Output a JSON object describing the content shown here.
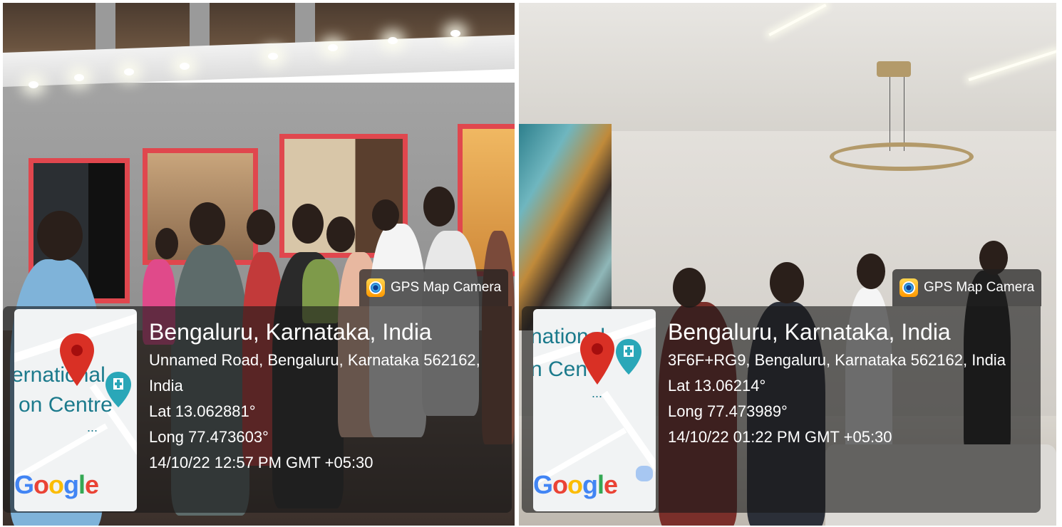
{
  "left": {
    "app_name": "GPS Map Camera",
    "location_title": "Bengaluru, Karnataka, India",
    "address_line1": "Unnamed Road, Bengaluru, Karnataka 562162,",
    "address_line2": "India",
    "latitude": "Lat 13.062881°",
    "longitude": "Long 77.473603°",
    "timestamp": "14/10/22 12:57 PM GMT +05:30",
    "map_text_line1": "ernational",
    "map_text_line2": "on Centre",
    "map_dots": "...",
    "map_logo": "Google"
  },
  "right": {
    "app_name": "GPS Map Camera",
    "location_title": "Bengaluru, Karnataka, India",
    "address_line1": "3F6F+RG9, Bengaluru, Karnataka 562162, India",
    "latitude": "Lat 13.06214°",
    "longitude": "Long 77.473989°",
    "timestamp": "14/10/22 01:22 PM GMT +05:30",
    "map_text_line1": "national",
    "map_text_line2": "n Cen",
    "map_dots": "...",
    "map_logo": "Google"
  },
  "colors": {
    "pin_red": "#d93025",
    "poi_teal": "#2aa7b8",
    "frame_red": "#e0474e",
    "google_blue": "#4285f4",
    "google_red": "#ea4335",
    "google_yellow": "#fbbc05",
    "google_green": "#34a853"
  },
  "icons": [
    "map-pin-icon",
    "hospital-poi-icon",
    "gps-map-camera-icon"
  ]
}
